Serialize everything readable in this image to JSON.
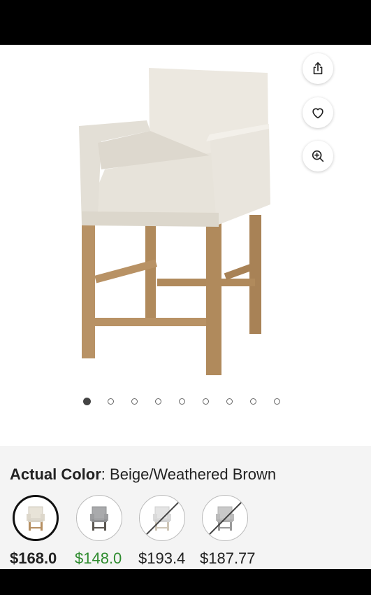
{
  "product": {
    "icons": {
      "share": "share-icon",
      "favorite": "heart-icon",
      "zoom": "zoom-in-icon"
    },
    "gallery": {
      "image": "beige upholstered counter stool with weathered brown wooden legs",
      "total_images": 9,
      "active_index": 0
    },
    "color": {
      "label": "Actual Color",
      "separator": ":",
      "value": "Beige/Weathered Brown"
    },
    "swatches": [
      {
        "icon": "beige-stool-swatch",
        "selected": true,
        "available": true
      },
      {
        "icon": "gray-stool-swatch",
        "selected": false,
        "available": true
      },
      {
        "icon": "white-stool-swatch",
        "selected": false,
        "available": false
      },
      {
        "icon": "charcoal-stool-swatch",
        "selected": false,
        "available": false
      }
    ],
    "prices": [
      "$168.0",
      "$148.0",
      "$193.4",
      "$187.77"
    ],
    "colors": {
      "sale_price": "#2e8b2e",
      "text": "#222222"
    }
  }
}
